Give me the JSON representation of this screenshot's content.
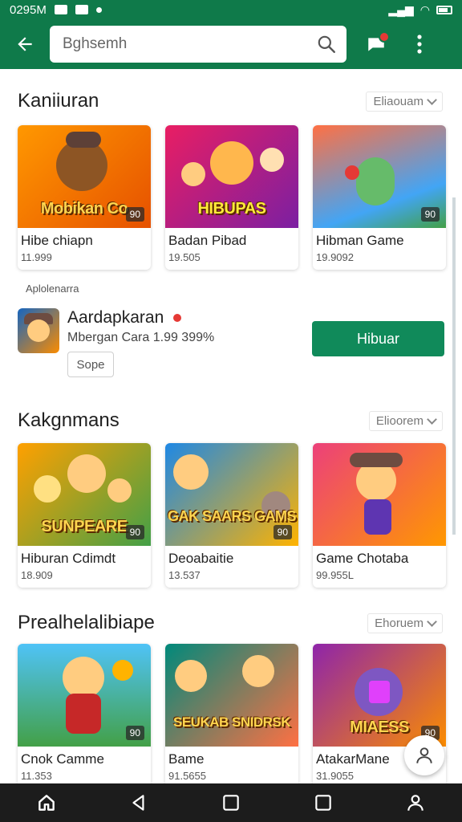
{
  "status_bar": {
    "time": "0295M"
  },
  "app_bar": {
    "search_placeholder": "Bghsemh"
  },
  "sections": [
    {
      "title": "Kaniiuran",
      "more_label": "Eliaouam",
      "cards": [
        {
          "thumb_title": "Mobikan Co",
          "badge": "90",
          "name": "Hibe chiapn",
          "meta": "11.999",
          "colors": [
            "#ff9800",
            "#e65100"
          ]
        },
        {
          "thumb_title": "HIBUPAS",
          "badge": "",
          "name": "Badan Pibad",
          "meta": "19.505",
          "colors": [
            "#e91e63",
            "#7b1fa2"
          ]
        },
        {
          "thumb_title": "",
          "badge": "90",
          "name": "Hibman Game",
          "meta": "19.9092",
          "colors": [
            "#ff7043",
            "#1e88e5"
          ]
        }
      ]
    },
    {
      "title": "Kakgnmans",
      "more_label": "Elioorem",
      "cards": [
        {
          "thumb_title": "SUNPEARE",
          "badge": "90",
          "name": "Hiburan Cdimdt",
          "meta": "18.909",
          "colors": [
            "#ffa000",
            "#43a047"
          ]
        },
        {
          "thumb_title": "GAK SAARS GAMS",
          "badge": "90",
          "name": "Deoabaitie",
          "meta": "13.537",
          "colors": [
            "#1e88e5",
            "#ffb300"
          ]
        },
        {
          "thumb_title": "",
          "badge": "",
          "name": "Game Chotaba",
          "meta": "99.955L",
          "colors": [
            "#ec407a",
            "#ff9800"
          ]
        }
      ]
    },
    {
      "title": "Prealhelalibiape",
      "more_label": "Ehoruem",
      "cards": [
        {
          "thumb_title": "",
          "badge": "90",
          "name": "Cnok Camme",
          "meta": "11.353",
          "colors": [
            "#43a047",
            "#ffca28"
          ]
        },
        {
          "thumb_title": "SEUKAB SNIDRSK",
          "badge": "",
          "name": "Bame",
          "meta": "91.5655",
          "colors": [
            "#00897b",
            "#ff7043"
          ]
        },
        {
          "thumb_title": "MIAESS",
          "badge": "90",
          "name": "AtakarMane",
          "meta": "31.9055",
          "colors": [
            "#8e24aa",
            "#fb8c00"
          ]
        }
      ]
    }
  ],
  "featured": {
    "label": "Aplolenarra",
    "name": "Aardapkaran",
    "meta": "Mbergan Cara 1.99 399%",
    "chip": "Sope",
    "install_label": "Hibuar"
  },
  "theme": {
    "primary": "#0f7a4a",
    "button": "#108a5a",
    "accent_red": "#e53935"
  }
}
